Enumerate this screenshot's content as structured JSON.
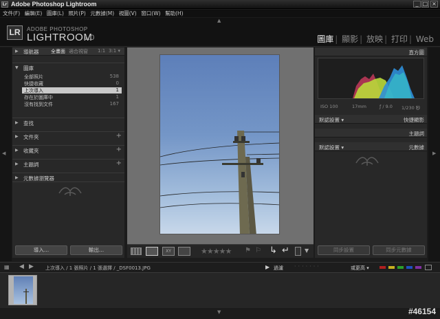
{
  "titlebar": {
    "icon": "Lr",
    "title": "Adobe Photoshop Lightroom"
  },
  "menu": [
    "文件(F)",
    "編輯(E)",
    "圖庫(L)",
    "照片(P)",
    "元數據(M)",
    "視圖(V)",
    "窗口(W)",
    "幫助(H)"
  ],
  "identity": {
    "badge": "LR",
    "line1": "ADOBE PHOTOSHOP",
    "line2": "LIGHTROOM",
    "version": "1.0"
  },
  "modules": [
    "圖庫",
    "顯影",
    "放映",
    "打印",
    "Web"
  ],
  "active_module": "圖庫",
  "navigator": {
    "label": "導航器",
    "zoom_options": [
      "全畫面",
      "適合視窗",
      "1:1",
      "3:1 ▾"
    ]
  },
  "left_sections": [
    {
      "label": "圖庫",
      "expanded": true
    },
    {
      "label": "查找"
    },
    {
      "label": "文件夾",
      "plus": "+"
    },
    {
      "label": "收藏夾",
      "plus": "+"
    },
    {
      "label": "主題詞",
      "plus": "+"
    },
    {
      "label": "元數據瀏覽器"
    }
  ],
  "library_items": [
    {
      "label": "全部照片",
      "count": "538"
    },
    {
      "label": "快捷收藏",
      "count": "0"
    },
    {
      "label": "上次導入",
      "count": "1",
      "selected": true
    },
    {
      "label": "存在於圖庫中",
      "count": "1"
    },
    {
      "label": "沒有找到文件",
      "count": "167"
    }
  ],
  "left_buttons": {
    "import": "導入...",
    "export": "輸出..."
  },
  "right_panel": {
    "histogram_label": "直方圖",
    "exif": [
      "ISO 100",
      "17mm",
      "ƒ / 9.0",
      "1/230 秒"
    ],
    "rows": [
      {
        "left": "默認設置 ▾",
        "right": "快捷顯影"
      },
      {
        "left": "",
        "right": "主題詞"
      },
      {
        "left": "默認設置 ▾",
        "right": "元數據"
      }
    ],
    "sync_settings": "同步設置",
    "sync_metadata": "同步元數據"
  },
  "filmstrip": {
    "breadcrumb": "上次導入 / 1 張照片 / 1 張選擇 / _DSF0013.JPG",
    "filter_label": "過濾",
    "sort_label": "或更高 ▾",
    "label_colors": [
      "#b02020",
      "#c8b020",
      "#2aa02a",
      "#2050c0",
      "#8030a0"
    ]
  },
  "watermark": "#46154",
  "colors": {
    "accent": "#f0f0f0",
    "panel": "#282828",
    "selected": "#c9c9c9"
  }
}
